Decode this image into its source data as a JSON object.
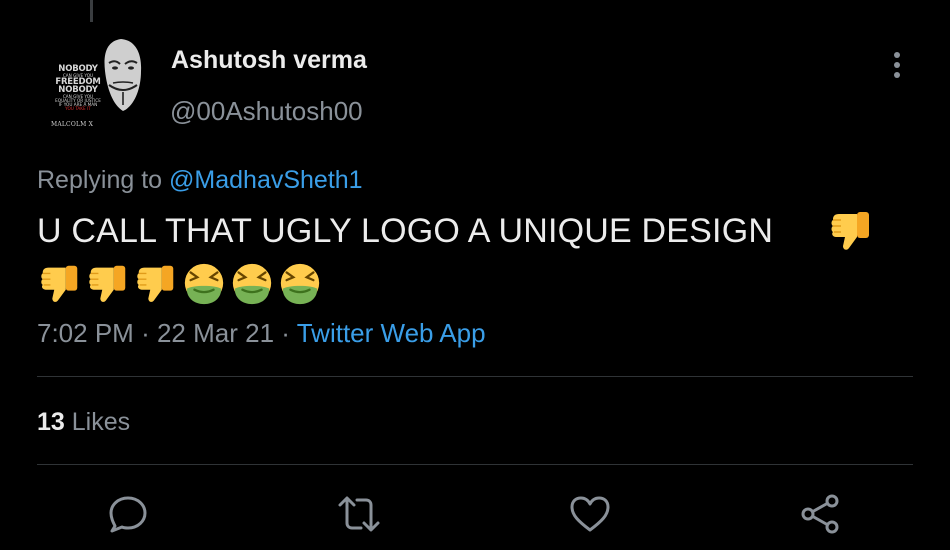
{
  "author": {
    "display_name": "Ashutosh verma",
    "handle": "@00Ashutosh00",
    "avatar_text": [
      "NOBODY",
      "CAN GIVE YOU",
      "FREEDOM",
      "NOBODY",
      "CAN GIVE YOU",
      "EQUALITY OR JUSTICE",
      "IF YOU ARE A MAN",
      "YOU TAKE IT",
      "MALCOLM X"
    ]
  },
  "reply": {
    "prefix": "Replying to",
    "mention": "@MadhavSheth1"
  },
  "tweet": {
    "text": "U CALL THAT UGLY LOGO A UNIQUE DESIGN",
    "emojis": [
      "thumbs-down-icon",
      "thumbs-down-icon",
      "thumbs-down-icon",
      "thumbs-down-icon",
      "nauseated-face-icon",
      "nauseated-face-icon",
      "nauseated-face-icon"
    ]
  },
  "meta": {
    "time": "7:02 PM",
    "separator": "·",
    "date": "22 Mar 21",
    "source": "Twitter Web App"
  },
  "stats": {
    "likes_count": "13",
    "likes_label": "Likes"
  },
  "actions": [
    "reply-icon",
    "retweet-icon",
    "like-icon",
    "share-icon"
  ],
  "colors": {
    "background": "#000000",
    "text": "#ececec",
    "secondary": "#8a9199",
    "link": "#3a9ee8",
    "divider": "#2f3336"
  }
}
